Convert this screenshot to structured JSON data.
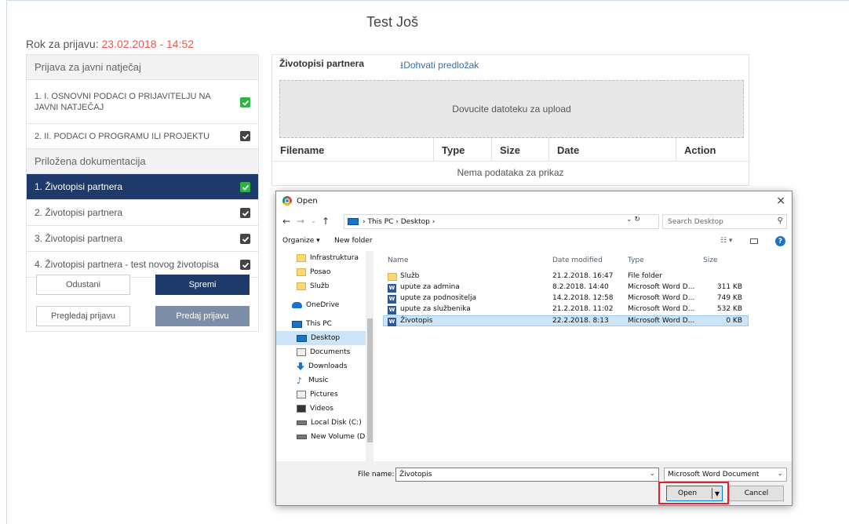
{
  "page": {
    "title": "Test Još",
    "deadline_label": "Rok za prijavu: ",
    "deadline_value": "23.02.2018 - 14:52"
  },
  "sidebar": {
    "section1": "Prijava za javni natječaj",
    "items1": [
      {
        "label": "1. I. OSNOVNI PODACI O PRIJAVITELJU NA JAVNI NATJEČAJ",
        "checked": true
      },
      {
        "label": "2. II. PODACI O PROGRAMU ILI PROJEKTU",
        "checked": true
      }
    ],
    "section2": "Priložena dokumentacija",
    "items2": [
      {
        "label": "1. Životopisi partnera",
        "checked": true,
        "active": true
      },
      {
        "label": "2. Životopisi partnera",
        "checked": true
      },
      {
        "label": "3. Životopisi partnera",
        "checked": true
      },
      {
        "label": "4. Životopisi partnera - test novog životopisa",
        "checked": true
      }
    ],
    "buttons": {
      "cancel": "Odustani",
      "save": "Spremi",
      "preview": "Pregledaj prijavu",
      "submit": "Predaj prijavu"
    }
  },
  "upload": {
    "title": "Životopisi partnera",
    "download_link": "Dohvati predložak",
    "dropzone": "Dovucite datoteku za upload",
    "columns": [
      "Filename",
      "Type",
      "Size",
      "Date",
      "Action"
    ],
    "empty": "Nema podataka za prikaz"
  },
  "dialog": {
    "title": "Open",
    "close": "×",
    "breadcrumb": "› This PC › Desktop ›",
    "search_placeholder": "Search Desktop",
    "organize": "Organize ▾",
    "new_folder": "New folder",
    "nav_items": [
      {
        "label": "Infrastruktura",
        "icon": "folder-icon"
      },
      {
        "label": "Posao",
        "icon": "folder-icon"
      },
      {
        "label": "Služb",
        "icon": "folder-icon"
      },
      {
        "label": "OneDrive",
        "icon": "onedrive-icon"
      },
      {
        "label": "This PC",
        "icon": "pc-icon"
      },
      {
        "label": "Desktop",
        "icon": "desktop-icon",
        "selected": true
      },
      {
        "label": "Documents",
        "icon": "documents-icon"
      },
      {
        "label": "Downloads",
        "icon": "downloads-icon"
      },
      {
        "label": "Music",
        "icon": "music-icon"
      },
      {
        "label": "Pictures",
        "icon": "pictures-icon"
      },
      {
        "label": "Videos",
        "icon": "videos-icon"
      },
      {
        "label": "Local Disk (C:)",
        "icon": "disk-icon"
      },
      {
        "label": "New Volume (D:",
        "icon": "drive-icon"
      }
    ],
    "columns": {
      "name": "Name",
      "date": "Date modified",
      "type": "Type",
      "size": "Size"
    },
    "files": [
      {
        "name": "Služb",
        "date": "21.2.2018. 16:47",
        "type": "File folder",
        "size": "",
        "icon": "folder-icon"
      },
      {
        "name": "upute za admina",
        "date": "8.2.2018. 14:40",
        "type": "Microsoft Word D...",
        "size": "311 KB",
        "icon": "word-icon"
      },
      {
        "name": "upute za podnositelja",
        "date": "14.2.2018. 12:58",
        "type": "Microsoft Word D...",
        "size": "749 KB",
        "icon": "word-icon"
      },
      {
        "name": "upute za službenika",
        "date": "21.2.2018. 11:02",
        "type": "Microsoft Word D...",
        "size": "532 KB",
        "icon": "word-icon"
      },
      {
        "name": "Životopis",
        "date": "22.2.2018. 8:13",
        "type": "Microsoft Word D...",
        "size": "0 KB",
        "icon": "word-icon",
        "selected": true
      }
    ],
    "filename_label": "File name:",
    "filename_value": "Životopis",
    "filetype": "Microsoft Word Document",
    "open_button": "Open",
    "cancel_button": "Cancel"
  }
}
